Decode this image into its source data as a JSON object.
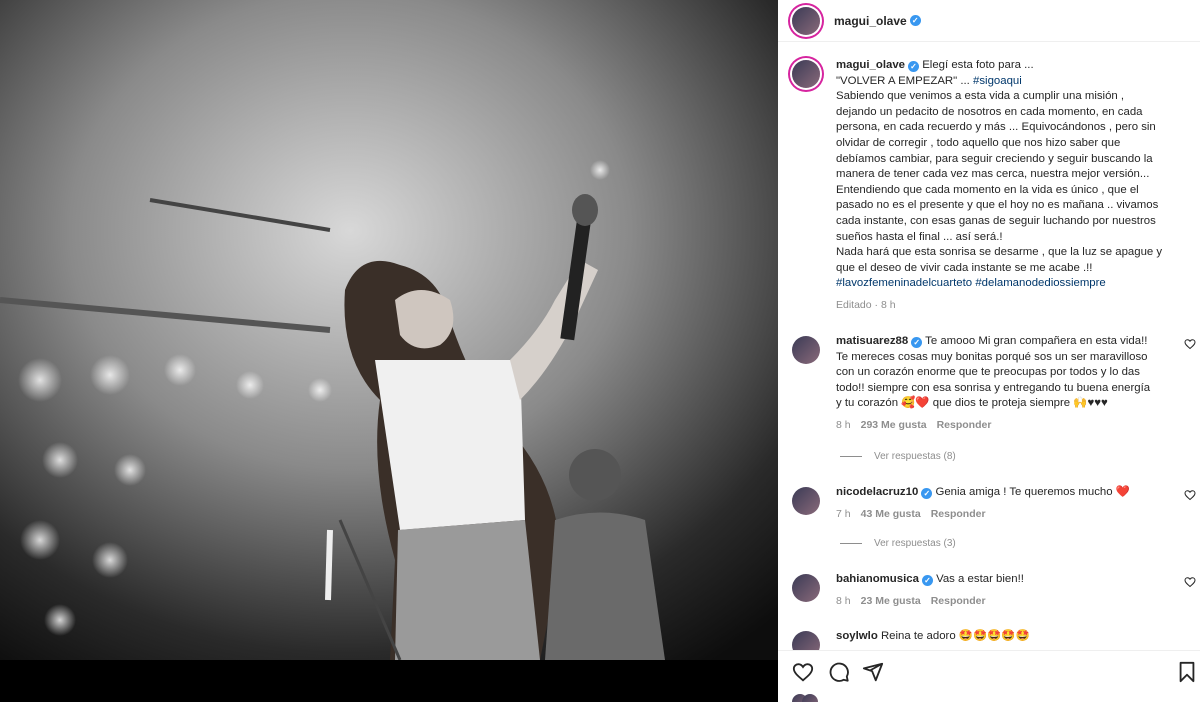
{
  "post": {
    "username": "magui_olave",
    "caption_lines": [
      "Elegí esta foto para ...",
      "\"VOLVER A EMPEZAR\" ... ",
      "Sabiendo que venimos a esta vida a cumplir una misión ,",
      "dejando un pedacito de nosotros en cada momento, en cada",
      "persona, en cada recuerdo y más ... Equivocándonos , pero sin",
      "olvidar de corregir , todo aquello que nos hizo saber que",
      "debíamos cambiar, para seguir creciendo y seguir buscando la",
      "manera de tener cada vez mas cerca, nuestra mejor versión...",
      "Entendiendo que cada momento en la vida es único , que el",
      "pasado no es el presente y que el hoy no es mañana .. vivamos",
      "cada instante, con esas ganas de seguir luchando por nuestros",
      "sueños hasta el final ... así será.!",
      "Nada hará que esta sonrisa se desarme , que la luz se apague y",
      "que el deseo de vivir cada instante se me acabe .!!"
    ],
    "caption_hashtag_inline": "#sigoaqui",
    "hashtags_line": [
      "#lavozfemeninadelcuarteto",
      "#delamanodediossiempre"
    ],
    "edited": "Editado · 8 h"
  },
  "comments": [
    {
      "username": "matisuarez88",
      "lines": [
        "Te amooo Mi gran compañera en esta vida!!",
        "Te mereces cosas muy bonitas porqué sos un ser maravilloso",
        "con un corazón enorme que te preocupas por todos y lo das",
        "todo!! siempre con esa sonrisa y entregando tu buena energía",
        "y tu corazón 🥰❤️ que dios te proteja siempre 🙌♥♥♥"
      ],
      "time": "8 h",
      "likes": "293 Me gusta",
      "reply": "Responder",
      "replies": "Ver respuestas (8)"
    },
    {
      "username": "nicodelacruz10",
      "lines": [
        "Genia amiga ! Te queremos mucho ❤️"
      ],
      "time": "7 h",
      "likes": "43 Me gusta",
      "reply": "Responder",
      "replies": "Ver respuestas (3)"
    },
    {
      "username": "bahianomusica",
      "lines": [
        "Vas a estar bien!!"
      ],
      "time": "8 h",
      "likes": "23 Me gusta",
      "reply": "Responder"
    },
    {
      "username": "soylwlo",
      "lines": [
        "Reina te adoro 🤩🤩🤩🤩🤩"
      ]
    }
  ],
  "icons": {
    "like": "heart-icon",
    "comment": "comment-icon",
    "share": "share-icon",
    "save": "bookmark-icon",
    "verified": "verified-badge-icon"
  },
  "colors": {
    "verified": "#3897f0",
    "hashtag": "#00376b",
    "heart_red": "#ed4956"
  }
}
